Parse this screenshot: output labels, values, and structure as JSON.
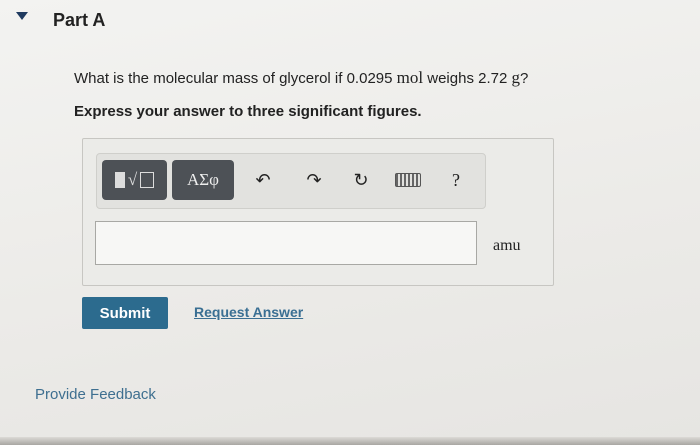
{
  "part": {
    "title": "Part A"
  },
  "question": {
    "prefix": "What is the molecular mass of glycerol if 0.0295 ",
    "unit1": "mol",
    "middle": " weighs 2.72 ",
    "unit2": "g",
    "suffix": "?"
  },
  "instruction": "Express your answer to three significant figures.",
  "toolbar": {
    "greek_label": "ΑΣφ",
    "root_glyph": "√",
    "help_label": "?",
    "undo_glyph": "↶",
    "redo_glyph": "↷",
    "reset_glyph": "↻"
  },
  "answer": {
    "value": "",
    "unit": "amu"
  },
  "actions": {
    "submit_label": "Submit",
    "request_answer_label": "Request Answer"
  },
  "footer": {
    "feedback_label": "Provide Feedback"
  },
  "colors": {
    "submit_bg": "#2c6b8e",
    "link": "#3a6f93",
    "toolbar_dark": "#4d5156"
  }
}
